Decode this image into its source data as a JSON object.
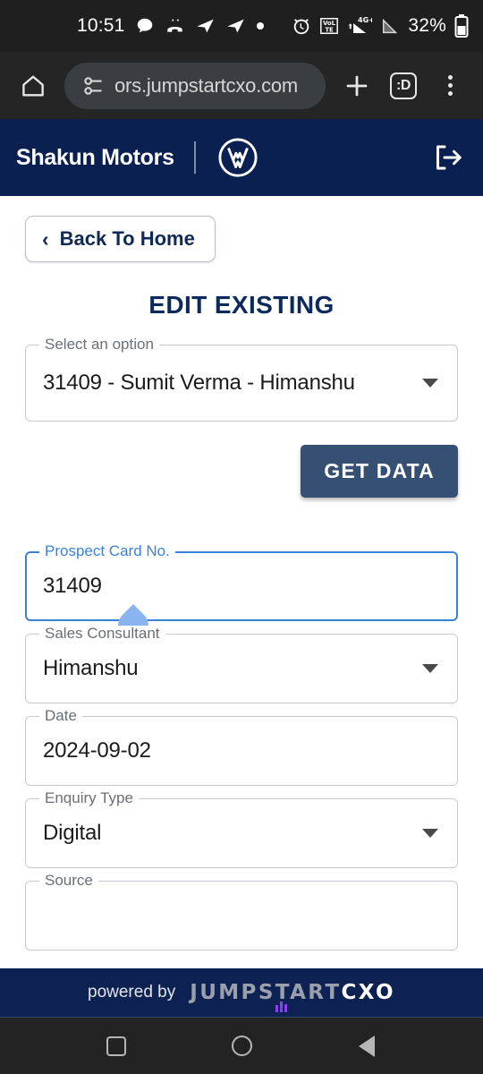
{
  "status_bar": {
    "time": "10:51",
    "battery_percent": "32%",
    "network": "4G+",
    "icons": [
      "chat-bubble-icon",
      "missed-call-icon",
      "telegram-icon",
      "telegram-icon",
      "dot-icon",
      "alarm-icon",
      "volte-icon",
      "signal-icon",
      "signal-off-icon",
      "battery-icon"
    ]
  },
  "browser": {
    "url": "ors.jumpstartcxo.com",
    "home_icon": "home-icon",
    "site_settings_icon": "tune-icon",
    "new_tab_icon": "plus-icon",
    "tab_count": ":D",
    "menu_icon": "kebab-menu-icon"
  },
  "header": {
    "brand": "Shakun Motors",
    "logo": "volkswagen-logo",
    "logout_icon": "logout-icon"
  },
  "main": {
    "back_button": "Back To Home",
    "back_chevron": "‹",
    "title": "EDIT EXISTING",
    "record_select": {
      "legend": "Select an option",
      "value": "31409 - Sumit Verma - Himanshu"
    },
    "get_data_button": "GET DATA",
    "fields": [
      {
        "legend": "Prospect Card No.",
        "value": "31409",
        "type": "text",
        "focused": true
      },
      {
        "legend": "Sales Consultant",
        "value": "Himanshu",
        "type": "select",
        "focused": false
      },
      {
        "legend": "Date",
        "value": "2024-09-02",
        "type": "text",
        "focused": false
      },
      {
        "legend": "Enquiry Type",
        "value": "Digital",
        "type": "select",
        "focused": false
      },
      {
        "legend": "Source",
        "value": "",
        "type": "select",
        "focused": false
      }
    ]
  },
  "footer": {
    "powered_by": "powered by",
    "logo_primary": "JUMPSTART",
    "logo_secondary": "CXO"
  },
  "nav_bar": {
    "recents": "recents-square-icon",
    "home": "home-circle-icon",
    "back": "back-triangle-icon"
  },
  "colors": {
    "header_navy": "#0a2050",
    "footer_navy": "#0d2252",
    "accent_blue": "#3b82d6",
    "button_slate": "#355073",
    "title_navy": "#0d2a5c"
  }
}
